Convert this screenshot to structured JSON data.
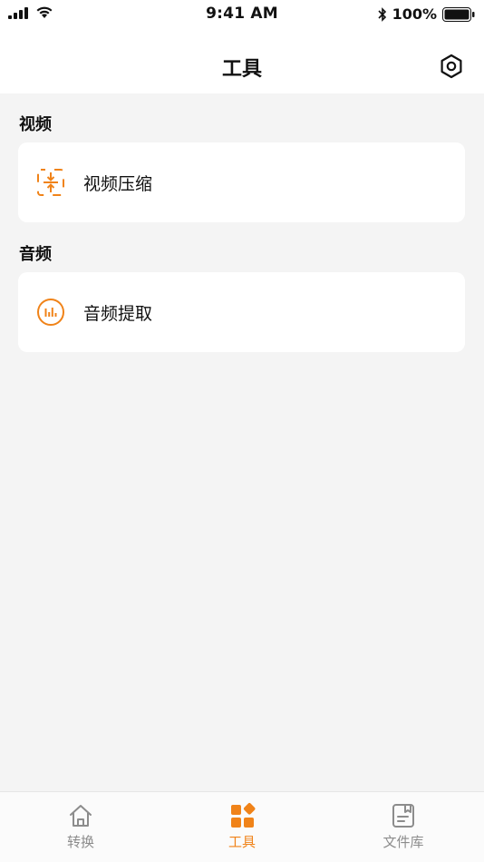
{
  "status_bar": {
    "time": "9:41 AM",
    "battery_percent": "100%"
  },
  "header": {
    "title": "工具",
    "settings_icon": "settings-hex-icon"
  },
  "sections": [
    {
      "title": "视频",
      "items": [
        {
          "label": "视频压缩",
          "icon": "compress-icon"
        }
      ]
    },
    {
      "title": "音频",
      "items": [
        {
          "label": "音频提取",
          "icon": "audio-wave-icon"
        }
      ]
    }
  ],
  "tab_bar": {
    "tabs": [
      {
        "label": "转换",
        "icon": "home-icon",
        "active": false
      },
      {
        "label": "工具",
        "icon": "grid-tools-icon",
        "active": true
      },
      {
        "label": "文件库",
        "icon": "file-icon",
        "active": false
      }
    ]
  },
  "colors": {
    "accent": "#f08319",
    "background": "#f4f4f4",
    "card": "#ffffff",
    "tab_inactive": "#8c8c8c"
  }
}
